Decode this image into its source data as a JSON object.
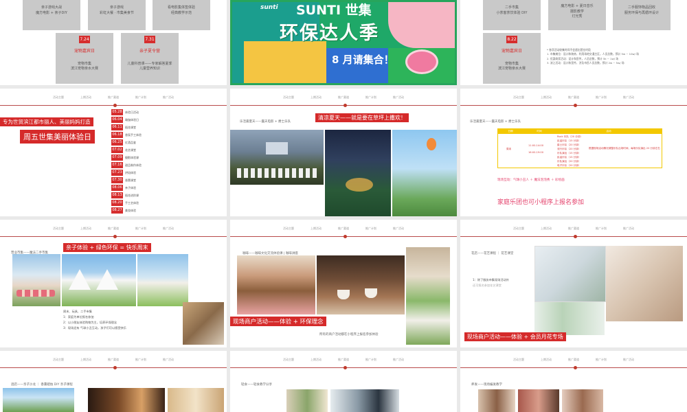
{
  "slide_1": {
    "top_boxes": [
      {
        "lines": [
          "亲子游戏大战",
          "魔方电影 + 亲子DIY"
        ]
      },
      {
        "lines": [
          "亲子游戏",
          "彩虹大餐 · 市集美食节"
        ]
      },
      {
        "lines": [
          "看电影集体签体验",
          "经典教学示范"
        ]
      }
    ],
    "dates": [
      {
        "date": "7.24",
        "title": "宠物嘉宾日",
        "lines": [
          "宠物市集",
          "滨江宠物亲水大赛"
        ]
      },
      {
        "date": "7.31",
        "title": "亲子夏令营",
        "lines": [
          "儿童科普课——专家解答夏季",
          "儿童营养知识"
        ]
      }
    ]
  },
  "slide_2": {
    "logo": "sunti",
    "line1": "SUNTI 世集",
    "line2": "环保达人季",
    "line3": "8 月请集合！"
  },
  "slide_3": {
    "top_boxes": [
      {
        "lines": [
          "二手市集",
          "小茶客茶饮体验 DIY"
        ]
      },
      {
        "lines": [
          "魔方电影 + 夏日音乐",
          "摄影教学",
          "灯光秀"
        ]
      },
      {
        "lines": [
          "二手服饰物品回收",
          "服务环保与再循环设计"
        ]
      }
    ],
    "date": "8.22",
    "date_title": "宠物嘉宾日",
    "date_lines": [
      "宠物市集",
      "滨江宠物亲水大赛"
    ],
    "notes": [
      "* 各项活动收集时间不会超出营业时段",
      "1. 市集摊位：设计和装修，利用场地交通主区，人员总数，预计 5w ~ 10w/ 场",
      "2. 优惠商家活动：设计和宣传，人员总数，预计 5k ~ 1w/ 场",
      "3. 滨江活动：设计和宣传，涉及市民人员总数，预计 2w ~ 5w/ 场"
    ]
  },
  "slide_4": {
    "tabs": [
      "活动主题",
      "上期活动",
      "推广渠道",
      "推广计划",
      "推广活动"
    ],
    "red_line": "专为世贸滨江都市丽人、美丽妈妈打造",
    "big_title": "周五世集美丽体验日",
    "schedule": [
      {
        "date": "05.28",
        "label": "体验日活动"
      },
      {
        "date": "06.04",
        "label": "瑜伽体验日"
      },
      {
        "date": "06.11",
        "label": "插花课堂"
      },
      {
        "date": "06.18",
        "label": "香氛手工体验"
      },
      {
        "date": "06.25",
        "label": "红酒品鉴"
      },
      {
        "date": "07.02",
        "label": "花艺课堂"
      },
      {
        "date": "07.09",
        "label": "摄影体验课"
      },
      {
        "date": "07.16",
        "label": "甜品制作体验"
      },
      {
        "date": "07.23",
        "label": "烘焙体验"
      },
      {
        "date": "07.30",
        "label": "香薰课堂"
      },
      {
        "date": "08.06",
        "label": "亲子体验"
      },
      {
        "date": "08.13",
        "label": "插花进阶课"
      },
      {
        "date": "08.20",
        "label": "手工艺体验"
      },
      {
        "date": "08.27",
        "label": "美妆体验"
      }
    ]
  },
  "slide_5": {
    "tabs": [
      "活动主题",
      "上期活动",
      "推广渠道",
      "推广计划",
      "推广活动"
    ],
    "subtitle": "乐活嘉夏天——露天电影 + 爵士乐队",
    "red_label": "清凉夏天——就是要在草坪上撒欢！"
  },
  "slide_6": {
    "tabs": [
      "活动主题",
      "上期活动",
      "推广渠道",
      "推广计划",
      "推广活动"
    ],
    "subtitle": "乐活嘉夏天——露天电影 + 爵士乐队",
    "table_headers": [
      "日期",
      "时间",
      "活动"
    ],
    "table_day": "周末",
    "table_times": [
      "11:00-14:00",
      "16:00-19:00"
    ],
    "table_items": [
      "Rock 乐队（20 分钟）",
      "民谣乐队（15 分钟）",
      "爵士乐队（20 分钟）",
      "流行乐队（20 分钟）",
      "乐队演出（15 分钟）",
      "民谣乐队（15 分钟）",
      "乐队演出（20 分钟）",
      "电子乐队（20 分钟）"
    ],
    "table_note": "根据现场活动情况调整乐队出场时间，每场乐队演出 20 分钟左右",
    "interaction": "现场互动：气球小丑人 ＋ 魔法泡泡秀 ＋ 彩绘画",
    "footer_text": "家庭乐团也可小程序上报名参加"
  },
  "slide_7": {
    "tabs": [
      "活动主题",
      "上期活动",
      "推广渠道",
      "推广计划",
      "推广活动"
    ],
    "header": "营业市集——魔法二手市集",
    "red_label": "亲子体验 + 绿色环保 = 快乐周末",
    "bullets": [
      "周末、玩具、二手市集",
      "1：家庭为单位报名参加",
      "2：以小朋友体验购物为主，培养环保理念",
      "3：现场还有 气球小丑互动，孩子们可以感受快乐"
    ]
  },
  "slide_8": {
    "tabs": [
      "活动主题",
      "上期活动",
      "推广渠道",
      "推广计划",
      "推广活动"
    ],
    "header": "咖啡——咖啡文化交流体验课 | 咖啡讲座",
    "red_label": "现场商户活动——体验 + 环保理念",
    "caption": "所有的商户活动都在小程序上报名参加体验"
  },
  "slide_9": {
    "tabs": [
      "活动主题",
      "上期活动",
      "推广渠道",
      "推广计划",
      "推广活动"
    ],
    "header": "花店——花艺课程 ｜ 花艺课堂",
    "bullets": [
      "1：除了服务市集现场活动外",
      "还可报名参加花艺课堂"
    ],
    "red_label": "现场商户活动——体验 + 会员月花专场"
  },
  "slide_10": {
    "tabs": [
      "活动主题",
      "上期活动",
      "推广渠道",
      "推广计划",
      "推广活动"
    ],
    "header": "酒店——亲子沙龙 ｜ 香薰蜡烛 DIY 亲子课程"
  },
  "slide_11": {
    "tabs": [
      "活动主题",
      "上期活动",
      "推广渠道",
      "推广计划",
      "推广活动"
    ],
    "header": "轻食——轻食教学分享"
  },
  "slide_12": {
    "tabs": [
      "活动主题",
      "上期活动",
      "推广渠道",
      "推广计划",
      "推广活动"
    ],
    "header": "养发——现场编发教学"
  }
}
